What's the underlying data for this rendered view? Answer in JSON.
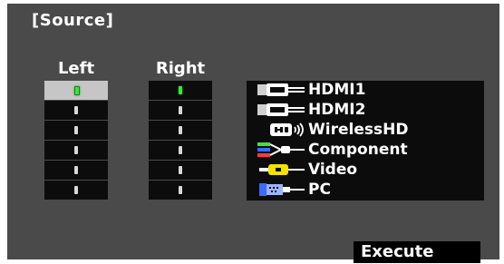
{
  "title": "[Source]",
  "columns": {
    "left": "Left",
    "right": "Right"
  },
  "left_column": [
    {
      "active": true,
      "selected": true
    },
    {
      "active": false,
      "selected": false
    },
    {
      "active": false,
      "selected": false
    },
    {
      "active": false,
      "selected": false
    },
    {
      "active": false,
      "selected": false
    },
    {
      "active": false,
      "selected": false
    }
  ],
  "right_column": [
    {
      "active": true,
      "selected": false
    },
    {
      "active": false,
      "selected": false
    },
    {
      "active": false,
      "selected": false
    },
    {
      "active": false,
      "selected": false
    },
    {
      "active": false,
      "selected": false
    },
    {
      "active": false,
      "selected": false
    }
  ],
  "sources": [
    {
      "label": "HDMI1",
      "icon": "hdmi-connector-icon"
    },
    {
      "label": "HDMI2",
      "icon": "hdmi-connector-icon"
    },
    {
      "label": "WirelessHD",
      "icon": "wireless-hd-icon"
    },
    {
      "label": "Component",
      "icon": "component-connector-icon"
    },
    {
      "label": "Video",
      "icon": "rca-video-connector-icon"
    },
    {
      "label": "PC",
      "icon": "vga-connector-icon"
    }
  ],
  "execute_label": "Execute",
  "colors": {
    "panel": "#4a4a4a",
    "cell": "#0c0c0c",
    "selected": "#c6c6c6",
    "led_on": "#39e639"
  }
}
